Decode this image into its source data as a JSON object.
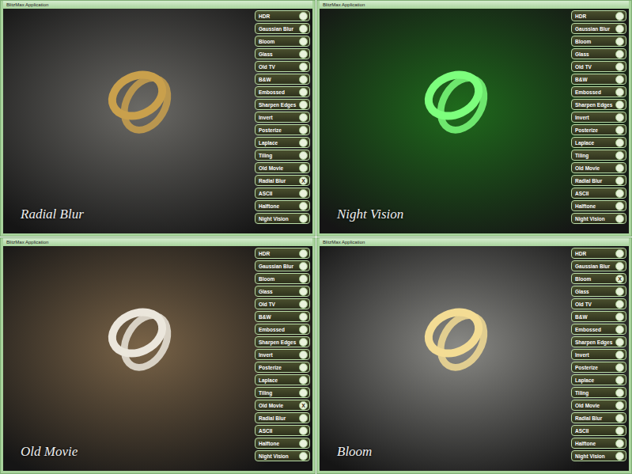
{
  "check_mark": "X",
  "windows": [
    {
      "title": "BlitzMax Application",
      "caption": "Radial Blur",
      "color": "#6b6a66",
      "knot_color": "#c9a04c",
      "effects": [
        {
          "label": "HDR",
          "checked": false
        },
        {
          "label": "Gaussian Blur",
          "checked": false
        },
        {
          "label": "Bloom",
          "checked": false
        },
        {
          "label": "Glass",
          "checked": false
        },
        {
          "label": "Old TV",
          "checked": false
        },
        {
          "label": "B&W",
          "checked": false
        },
        {
          "label": "Embossed",
          "checked": false
        },
        {
          "label": "Sharpen Edges",
          "checked": false
        },
        {
          "label": "Invert",
          "checked": false
        },
        {
          "label": "Posterize",
          "checked": false
        },
        {
          "label": "Laplace",
          "checked": false
        },
        {
          "label": "Tiling",
          "checked": false
        },
        {
          "label": "Old Movie",
          "checked": false
        },
        {
          "label": "Radial Blur",
          "checked": true
        },
        {
          "label": "ASCII",
          "checked": false
        },
        {
          "label": "Halftone",
          "checked": false
        },
        {
          "label": "Night Vision",
          "checked": false
        }
      ]
    },
    {
      "title": "BlitzMax Application",
      "caption": "Night Vision",
      "color": "#1f6a1c",
      "knot_color": "#7dff7d",
      "effects": [
        {
          "label": "HDR",
          "checked": false
        },
        {
          "label": "Gaussian Blur",
          "checked": false
        },
        {
          "label": "Bloom",
          "checked": false
        },
        {
          "label": "Glass",
          "checked": false
        },
        {
          "label": "Old TV",
          "checked": false
        },
        {
          "label": "B&W",
          "checked": false
        },
        {
          "label": "Embossed",
          "checked": false
        },
        {
          "label": "Sharpen Edges",
          "checked": false
        },
        {
          "label": "Invert",
          "checked": false
        },
        {
          "label": "Posterize",
          "checked": false
        },
        {
          "label": "Laplace",
          "checked": false
        },
        {
          "label": "Tiling",
          "checked": false
        },
        {
          "label": "Old Movie",
          "checked": false
        },
        {
          "label": "Radial Blur",
          "checked": false
        },
        {
          "label": "ASCII",
          "checked": false
        },
        {
          "label": "Halftone",
          "checked": false
        },
        {
          "label": "Night Vision",
          "checked": false
        }
      ]
    },
    {
      "title": "BlitzMax Application",
      "caption": "Old Movie",
      "color": "#7a6448",
      "knot_color": "#ebe6dc",
      "effects": [
        {
          "label": "HDR",
          "checked": false
        },
        {
          "label": "Gaussian Blur",
          "checked": false
        },
        {
          "label": "Bloom",
          "checked": false
        },
        {
          "label": "Glass",
          "checked": false
        },
        {
          "label": "Old TV",
          "checked": false
        },
        {
          "label": "B&W",
          "checked": false
        },
        {
          "label": "Embossed",
          "checked": false
        },
        {
          "label": "Sharpen Edges",
          "checked": false
        },
        {
          "label": "Invert",
          "checked": false
        },
        {
          "label": "Posterize",
          "checked": false
        },
        {
          "label": "Laplace",
          "checked": false
        },
        {
          "label": "Tiling",
          "checked": false
        },
        {
          "label": "Old Movie",
          "checked": true
        },
        {
          "label": "Radial Blur",
          "checked": false
        },
        {
          "label": "ASCII",
          "checked": false
        },
        {
          "label": "Halftone",
          "checked": false
        },
        {
          "label": "Night Vision",
          "checked": false
        }
      ]
    },
    {
      "title": "BlitzMax Application",
      "caption": "Bloom",
      "color": "#8a8a86",
      "knot_color": "#f3dc94",
      "effects": [
        {
          "label": "HDR",
          "checked": false
        },
        {
          "label": "Gaussian Blur",
          "checked": false
        },
        {
          "label": "Bloom",
          "checked": true
        },
        {
          "label": "Glass",
          "checked": false
        },
        {
          "label": "Old TV",
          "checked": false
        },
        {
          "label": "B&W",
          "checked": false
        },
        {
          "label": "Embossed",
          "checked": false
        },
        {
          "label": "Sharpen Edges",
          "checked": false
        },
        {
          "label": "Invert",
          "checked": false
        },
        {
          "label": "Posterize",
          "checked": false
        },
        {
          "label": "Laplace",
          "checked": false
        },
        {
          "label": "Tiling",
          "checked": false
        },
        {
          "label": "Old Movie",
          "checked": false
        },
        {
          "label": "Radial Blur",
          "checked": false
        },
        {
          "label": "ASCII",
          "checked": false
        },
        {
          "label": "Halftone",
          "checked": false
        },
        {
          "label": "Night Vision",
          "checked": false
        }
      ]
    }
  ]
}
